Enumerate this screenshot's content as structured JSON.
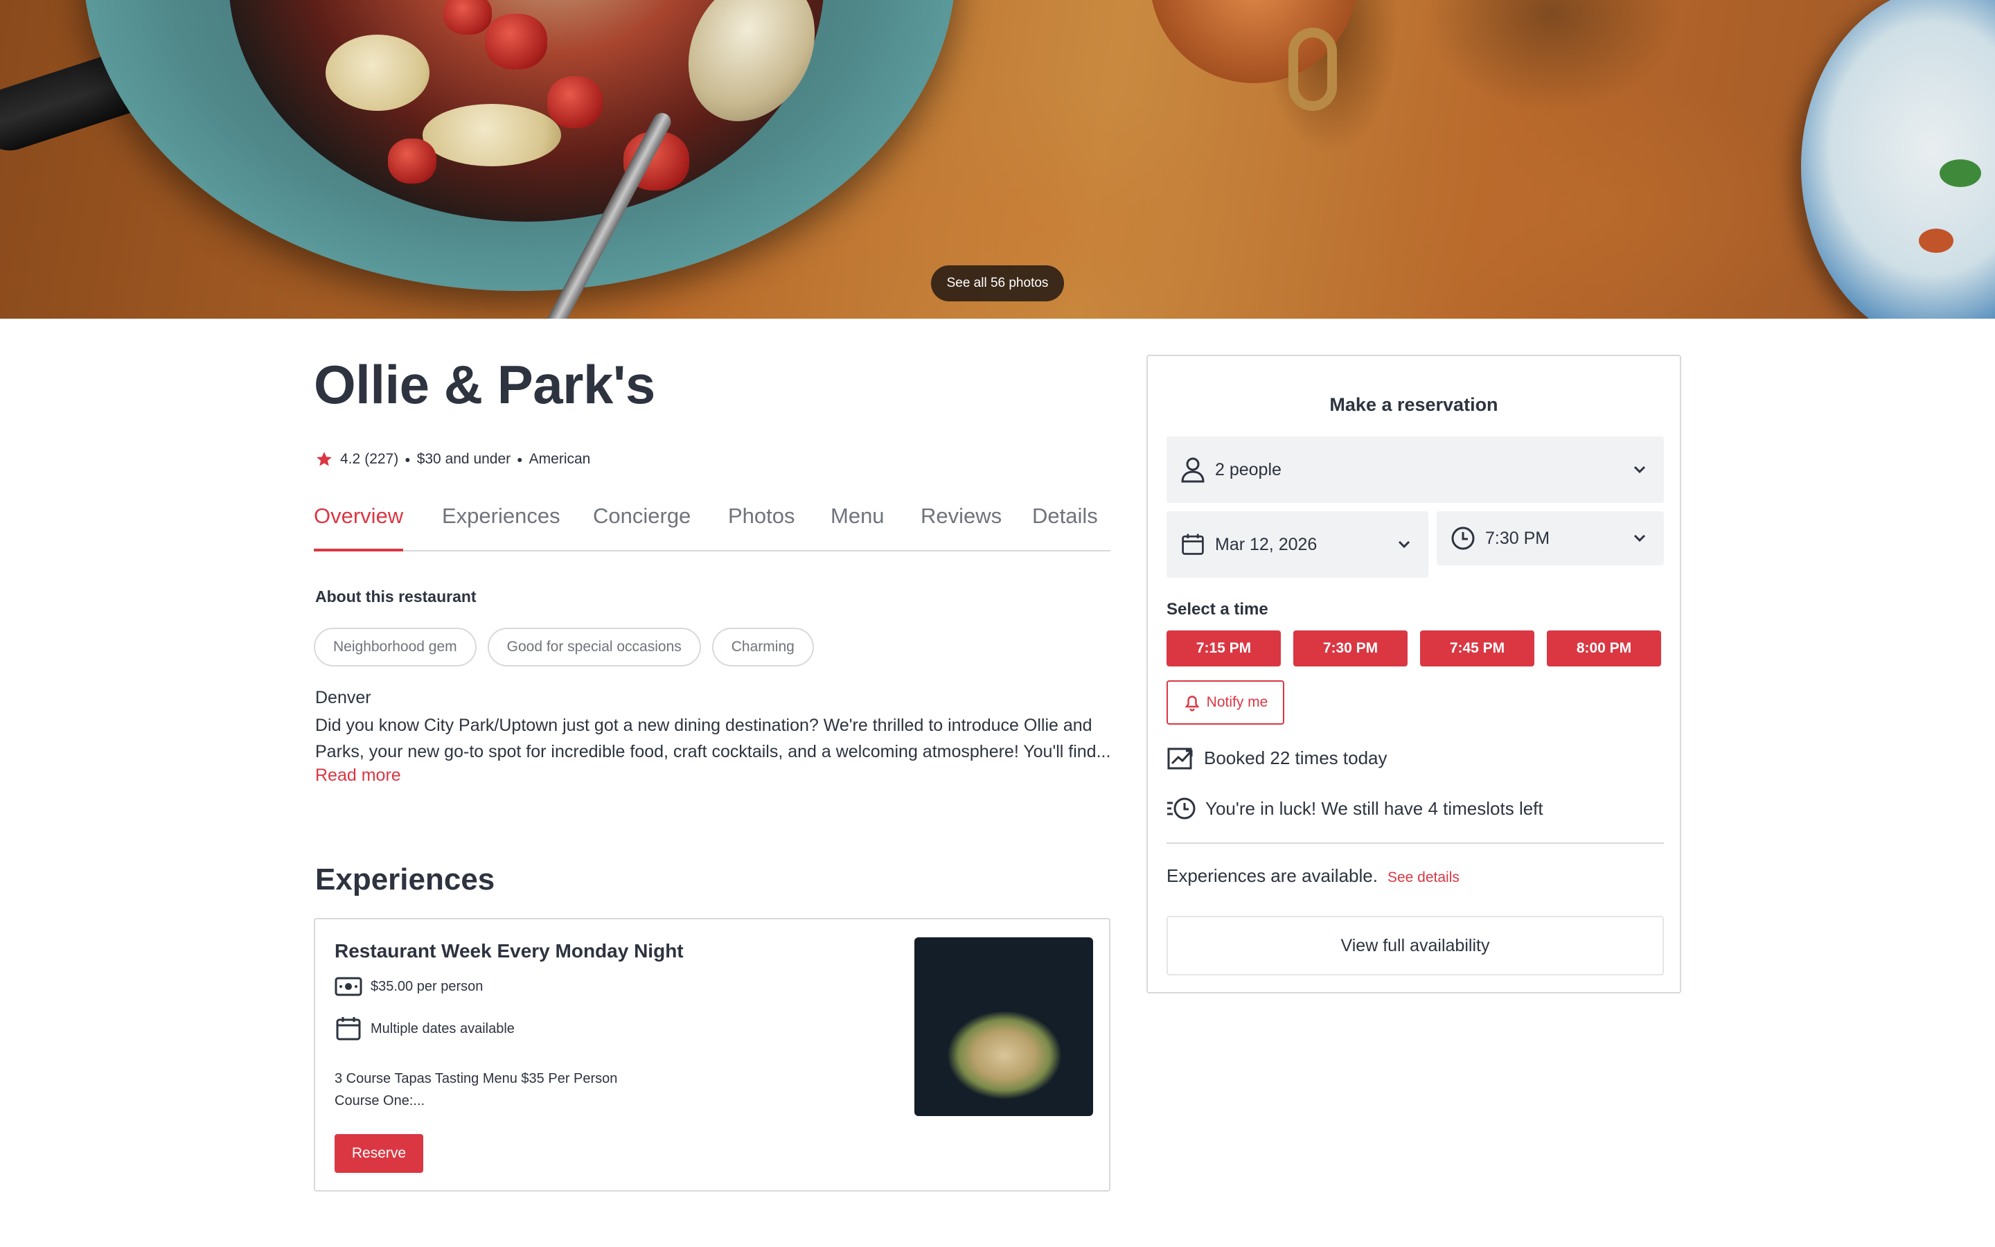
{
  "hero": {
    "photos_button": "See all 56 photos"
  },
  "restaurant": {
    "name": "Ollie & Park's",
    "rating": "4.2",
    "reviews": "(227)",
    "price": "$30 and under",
    "cuisine": "American"
  },
  "tabs": [
    "Overview",
    "Experiences",
    "Concierge",
    "Photos",
    "Menu",
    "Reviews",
    "Details"
  ],
  "about": {
    "heading": "About this restaurant",
    "tags": [
      "Neighborhood gem",
      "Good for special occasions",
      "Charming"
    ],
    "city": "Denver",
    "description": "Did you know City Park/Uptown just got a new dining destination? We're thrilled to introduce Ollie and Parks, your new go-to spot for incredible food, craft cocktails, and a welcoming atmosphere! You'll find...",
    "read_more": "Read more"
  },
  "experiences": {
    "heading": "Experiences",
    "card": {
      "title": "Restaurant Week Every Monday Night",
      "price": "$35.00 per person",
      "dates": "Multiple dates available",
      "desc_line1": "3 Course Tapas Tasting Menu $35 Per Person",
      "desc_line2": "Course One:...",
      "reserve": "Reserve"
    }
  },
  "reservation": {
    "title": "Make a reservation",
    "party": "2 people",
    "date": "Mar 12, 2026",
    "time": "7:30 PM",
    "select_heading": "Select a time",
    "slots": [
      "7:15 PM",
      "7:30 PM",
      "7:45 PM",
      "8:00 PM"
    ],
    "notify": "Notify me",
    "booked": "Booked 22 times today",
    "luck": "You're in luck! We still have 4 timeslots left",
    "experiences_available": "Experiences are available.",
    "see_details": "See details",
    "full_availability": "View full availability"
  },
  "colors": {
    "accent": "#da3743",
    "text": "#2d333f",
    "muted": "#6f737b",
    "border": "#d8d9db",
    "field_bg": "#f1f2f4"
  }
}
